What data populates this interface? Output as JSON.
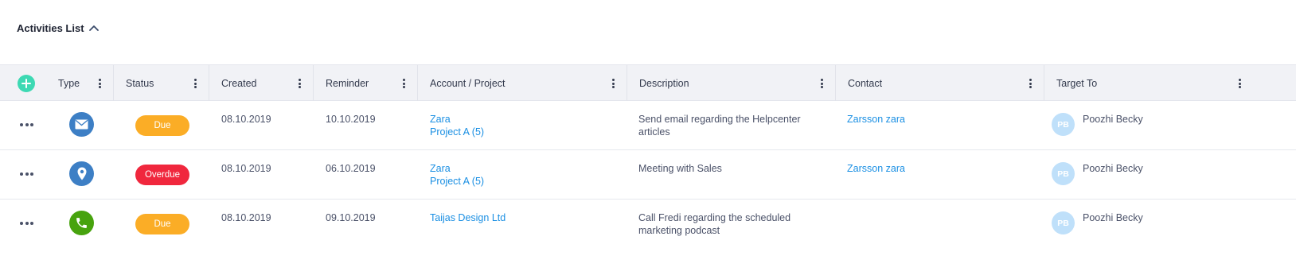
{
  "section": {
    "title": "Activities List",
    "expanded": true
  },
  "colors": {
    "accent_add": "#3dd9b3",
    "link": "#1a8fe3",
    "status_due": "#fbad26",
    "status_overdue": "#f0273d",
    "type_email": "#3d7fc5",
    "type_meeting": "#3d7fc5",
    "type_call": "#47a30e",
    "avatar_bg": "#bfe0fa"
  },
  "columns": [
    {
      "key": "type",
      "label": "Type"
    },
    {
      "key": "status",
      "label": "Status"
    },
    {
      "key": "created",
      "label": "Created"
    },
    {
      "key": "reminder",
      "label": "Reminder"
    },
    {
      "key": "account",
      "label": "Account / Project"
    },
    {
      "key": "description",
      "label": "Description"
    },
    {
      "key": "contact",
      "label": "Contact"
    },
    {
      "key": "target",
      "label": "Target To"
    }
  ],
  "rows": [
    {
      "type_icon": "envelope-icon",
      "status": "Due",
      "status_color": "#fbad26",
      "created": "08.10.2019",
      "reminder": "10.10.2019",
      "account": "Zara",
      "project": "Project A (5)",
      "description": "Send email regarding the Helpcenter articles",
      "contact": "Zarsson zara",
      "target_initials": "PB",
      "target_name": "Poozhi Becky"
    },
    {
      "type_icon": "map-pin-icon",
      "status": "Overdue",
      "status_color": "#f0273d",
      "created": "08.10.2019",
      "reminder": "06.10.2019",
      "account": "Zara",
      "project": "Project A (5)",
      "description": "Meeting with Sales",
      "contact": "Zarsson zara",
      "target_initials": "PB",
      "target_name": "Poozhi Becky"
    },
    {
      "type_icon": "phone-icon",
      "status": "Due",
      "status_color": "#fbad26",
      "created": "08.10.2019",
      "reminder": "09.10.2019",
      "account": "Taijas Design Ltd",
      "project": "",
      "description": "Call Fredi regarding the scheduled marketing podcast",
      "contact": "",
      "target_initials": "PB",
      "target_name": "Poozhi Becky"
    }
  ]
}
